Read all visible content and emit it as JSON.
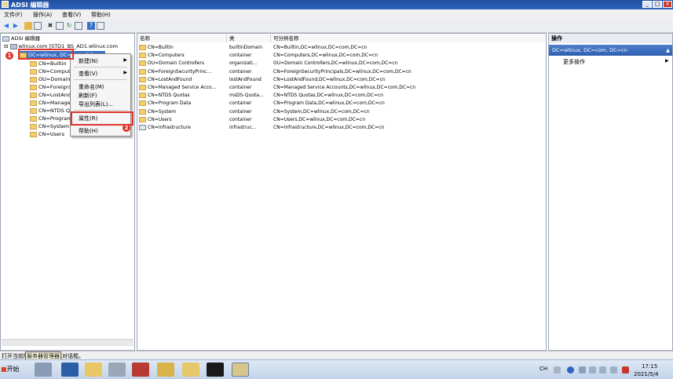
{
  "window": {
    "title": "ADSI 编辑器"
  },
  "menubar": [
    "文件(F)",
    "操作(A)",
    "查看(V)",
    "帮助(H)"
  ],
  "tree": {
    "root": "ADSI 编辑器",
    "connection": "wlinux.com [STD1_BS_AD1.wlinux.com",
    "selected": "DC=wlinux, DC=com, DC=cn",
    "children": [
      "CN=Builtin",
      "CN=Computers",
      "OU=Domain Controllers",
      "CN=ForeignSecurityPrincipals",
      "CN=LostAndFound",
      "CN=Managed Service Accounts",
      "CN=NTDS Quotas",
      "CN=Program Data",
      "CN=System",
      "CN=Users"
    ]
  },
  "list": {
    "headers": [
      "名称",
      "类",
      "可分辨名称"
    ],
    "rows": [
      {
        "name": "CN=Builtin",
        "class": "builtinDomain",
        "dn": "CN=Builtin,DC=wlinux,DC=com,DC=cn"
      },
      {
        "name": "CN=Computers",
        "class": "container",
        "dn": "CN=Computers,DC=wlinux,DC=com,DC=cn"
      },
      {
        "name": "OU=Domain Controllers",
        "class": "organizati...",
        "dn": "OU=Domain Controllers,DC=wlinux,DC=com,DC=cn"
      },
      {
        "name": "CN=ForeignSecurityPrinc...",
        "class": "container",
        "dn": "CN=ForeignSecurityPrincipals,DC=wlinux,DC=com,DC=cn"
      },
      {
        "name": "CN=LostAndFound",
        "class": "lostAndFound",
        "dn": "CN=LostAndFound,DC=wlinux,DC=com,DC=cn"
      },
      {
        "name": "CN=Managed Service Acco...",
        "class": "container",
        "dn": "CN=Managed Service Accounts,DC=wlinux,DC=com,DC=cn"
      },
      {
        "name": "CN=NTDS Quotas",
        "class": "msDS-Quota...",
        "dn": "CN=NTDS Quotas,DC=wlinux,DC=com,DC=cn"
      },
      {
        "name": "CN=Program Data",
        "class": "container",
        "dn": "CN=Program Data,DC=wlinux,DC=com,DC=cn"
      },
      {
        "name": "CN=System",
        "class": "container",
        "dn": "CN=System,DC=wlinux,DC=com,DC=cn"
      },
      {
        "name": "CN=Users",
        "class": "container",
        "dn": "CN=Users,DC=wlinux,DC=com,DC=cn"
      },
      {
        "name": "CN=Infrastructure",
        "class": "infrastruc...",
        "dn": "CN=Infrastructure,DC=wlinux,DC=com,DC=cn"
      }
    ]
  },
  "context_menu": {
    "new": "新建(N)",
    "view": "查看(V)",
    "rename": "重命名(M)",
    "refresh": "刷新(F)",
    "export": "导出列表(L)...",
    "properties": "属性(R)",
    "help": "帮助(H)"
  },
  "actions": {
    "title": "操作",
    "selected": "DC=wlinux, DC=com, DC=cn",
    "more": "更多操作"
  },
  "annotations": {
    "step1": "1",
    "step2": "2"
  },
  "status": {
    "text": "打开当前所选内容的属性对话框。",
    "tooltip": "服务器管理器"
  },
  "taskbar": {
    "start": "开始",
    "lang": "CH",
    "time": "17:15",
    "date": "2021/5/4"
  },
  "colors": {
    "highlight": "#e0322b",
    "selection": "#3a6fc6",
    "title": "#2d63c0"
  }
}
